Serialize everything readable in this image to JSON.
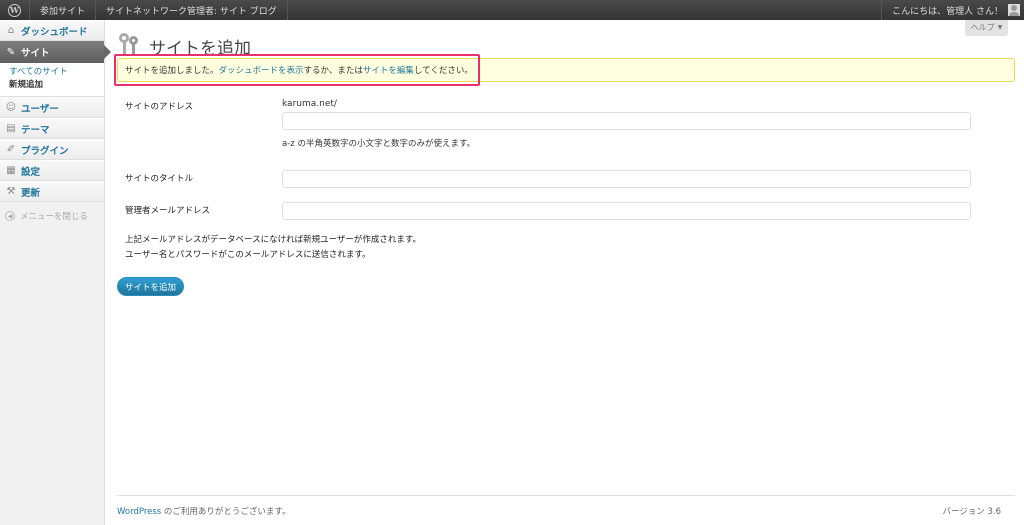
{
  "adminbar": {
    "wp_logo": "W",
    "my_sites": "参加サイト",
    "network_admin": "サイトネットワーク管理者: サイト ブログ",
    "greeting": "こんにちは、管理人 さん！"
  },
  "sidebar": {
    "items": [
      {
        "label": "ダッシュボード",
        "icon": "home-icon",
        "glyph": "⌂"
      },
      {
        "label": "サイト",
        "icon": "sites-icon",
        "glyph": "✎"
      },
      {
        "label": "ユーザー",
        "icon": "users-icon",
        "glyph": "☺"
      },
      {
        "label": "テーマ",
        "icon": "themes-icon",
        "glyph": "▤"
      },
      {
        "label": "プラグイン",
        "icon": "plugins-icon",
        "glyph": "✐"
      },
      {
        "label": "設定",
        "icon": "settings-icon",
        "glyph": "▦"
      },
      {
        "label": "更新",
        "icon": "updates-icon",
        "glyph": "⚒"
      }
    ],
    "submenu": [
      "すべてのサイト",
      "新規追加"
    ],
    "collapse": "メニューを閉じる"
  },
  "help": "ヘルプ",
  "page": {
    "title": "サイトを追加"
  },
  "notice": {
    "text1": "サイトを追加しました。",
    "link1": "ダッシュボードを表示",
    "text2": "するか、または",
    "link2": "サイトを編集",
    "text3": "してください。"
  },
  "form": {
    "address_label": "サイトのアドレス",
    "domain": "karuma.net/",
    "address_value": "",
    "address_desc": "a-z の半角英数字の小文字と数字のみが使えます。",
    "title_label": "サイトのタイトル",
    "title_value": "",
    "email_label": "管理者メールアドレス",
    "email_value": "",
    "note1": "上記メールアドレスがデータベースになければ新規ユーザーが作成されます。",
    "note2": "ユーザー名とパスワードがこのメールアドレスに送信されます。",
    "submit": "サイトを追加"
  },
  "footer": {
    "link": "WordPress",
    "text": " のご利用ありがとうございます。",
    "version": "バージョン 3.6"
  },
  "colors": {
    "accent": "#21759b",
    "notice_bg": "#ffffe0",
    "highlight": "#e8306a"
  }
}
